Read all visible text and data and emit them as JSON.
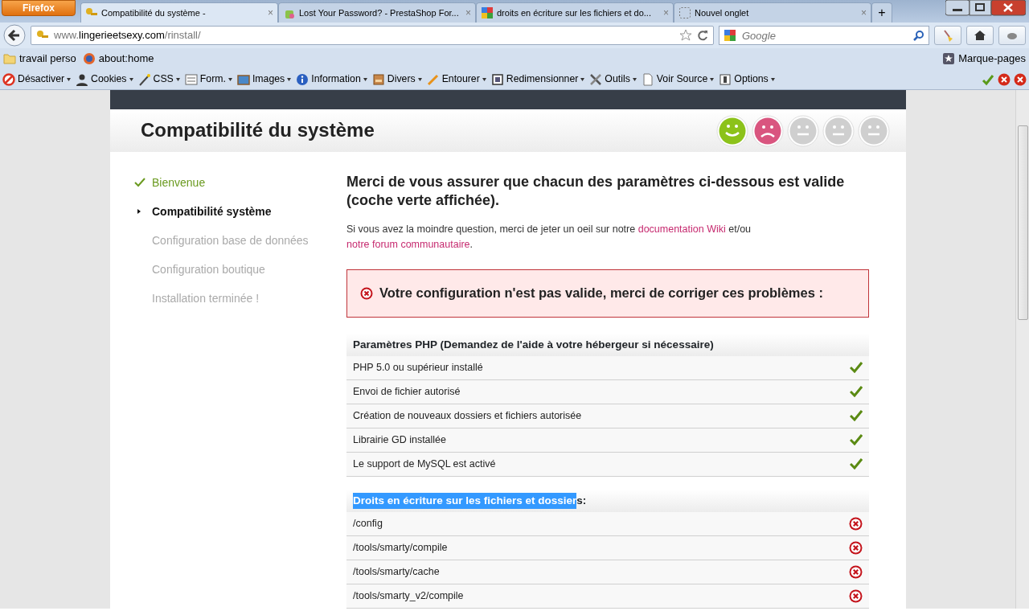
{
  "browser": {
    "menu_button": "Firefox",
    "tabs": [
      {
        "label": "Compatibilité du système -",
        "selected": true,
        "close": "×"
      },
      {
        "label": "Lost Your Password? - PrestaShop For...",
        "selected": false,
        "close": "×"
      },
      {
        "label": "droits en écriture sur les fichiers et do...",
        "selected": false,
        "close": "×"
      },
      {
        "label": "Nouvel onglet",
        "selected": false,
        "close": "×"
      }
    ],
    "new_tab": "+",
    "address": {
      "prefix": "www.",
      "domain": "lingerieetsexy.com",
      "path": "/rinstall/"
    },
    "search": {
      "placeholder": "Google"
    },
    "bookmarks": [
      {
        "label": "travail perso"
      },
      {
        "label": "about:home"
      }
    ],
    "bookmarks_menu": "Marque-pages",
    "dev_toolbar": [
      {
        "label": "Désactiver"
      },
      {
        "label": "Cookies"
      },
      {
        "label": "CSS"
      },
      {
        "label": "Form."
      },
      {
        "label": "Images"
      },
      {
        "label": "Information"
      },
      {
        "label": "Divers"
      },
      {
        "label": "Entourer"
      },
      {
        "label": "Redimensionner"
      },
      {
        "label": "Outils"
      },
      {
        "label": "Voir Source"
      },
      {
        "label": "Options"
      }
    ]
  },
  "page": {
    "title": "Compatibilité du système",
    "moods": [
      {
        "kind": "happy"
      },
      {
        "kind": "sad"
      },
      {
        "kind": "neutral"
      },
      {
        "kind": "neutral"
      },
      {
        "kind": "neutral"
      }
    ],
    "steps": [
      {
        "label": "Bienvenue",
        "done": true,
        "selected": false
      },
      {
        "label": "Compatibilité système",
        "done": false,
        "selected": true
      },
      {
        "label": "Configuration base de données",
        "done": false,
        "selected": false
      },
      {
        "label": "Configuration boutique",
        "done": false,
        "selected": false
      },
      {
        "label": "Installation terminée !",
        "done": false,
        "selected": false
      }
    ],
    "heading": "Merci de vous assurer que chacun des paramètres ci-dessous est valide (coche verte affichée).",
    "intro": [
      {
        "text": "Si vous avez la moindre question, merci de jeter un oeil sur notre ",
        "link": false
      },
      {
        "text": "documentation Wiki",
        "link": true
      },
      {
        "text": " et/ou ",
        "link": false
      },
      {
        "text": "notre forum communautaire",
        "link": true
      },
      {
        "text": ".",
        "link": false
      }
    ],
    "error": "Votre configuration n'est pas valide, merci de corriger ces problèmes :",
    "sections": [
      {
        "heading": [
          {
            "text": "Paramètres PHP (Demandez de l'aide à votre hébergeur si nécessaire)",
            "selected": false
          }
        ],
        "rows": [
          {
            "label": "PHP 5.0 ou supérieur installé",
            "ok": true
          },
          {
            "label": "Envoi de fichier autorisé",
            "ok": true
          },
          {
            "label": "Création de nouveaux dossiers et fichiers autorisée",
            "ok": true
          },
          {
            "label": "Librairie GD installée",
            "ok": true
          },
          {
            "label": "Le support de MySQL est activé",
            "ok": true
          }
        ]
      },
      {
        "heading": [
          {
            "text": "Droits en écriture sur les fichiers et dossier",
            "selected": true
          },
          {
            "text": "s:",
            "selected": false
          }
        ],
        "rows": [
          {
            "label": "/config",
            "ok": false
          },
          {
            "label": "/tools/smarty/compile",
            "ok": false
          },
          {
            "label": "/tools/smarty/cache",
            "ok": false
          },
          {
            "label": "/tools/smarty_v2/compile",
            "ok": false
          }
        ]
      }
    ]
  }
}
